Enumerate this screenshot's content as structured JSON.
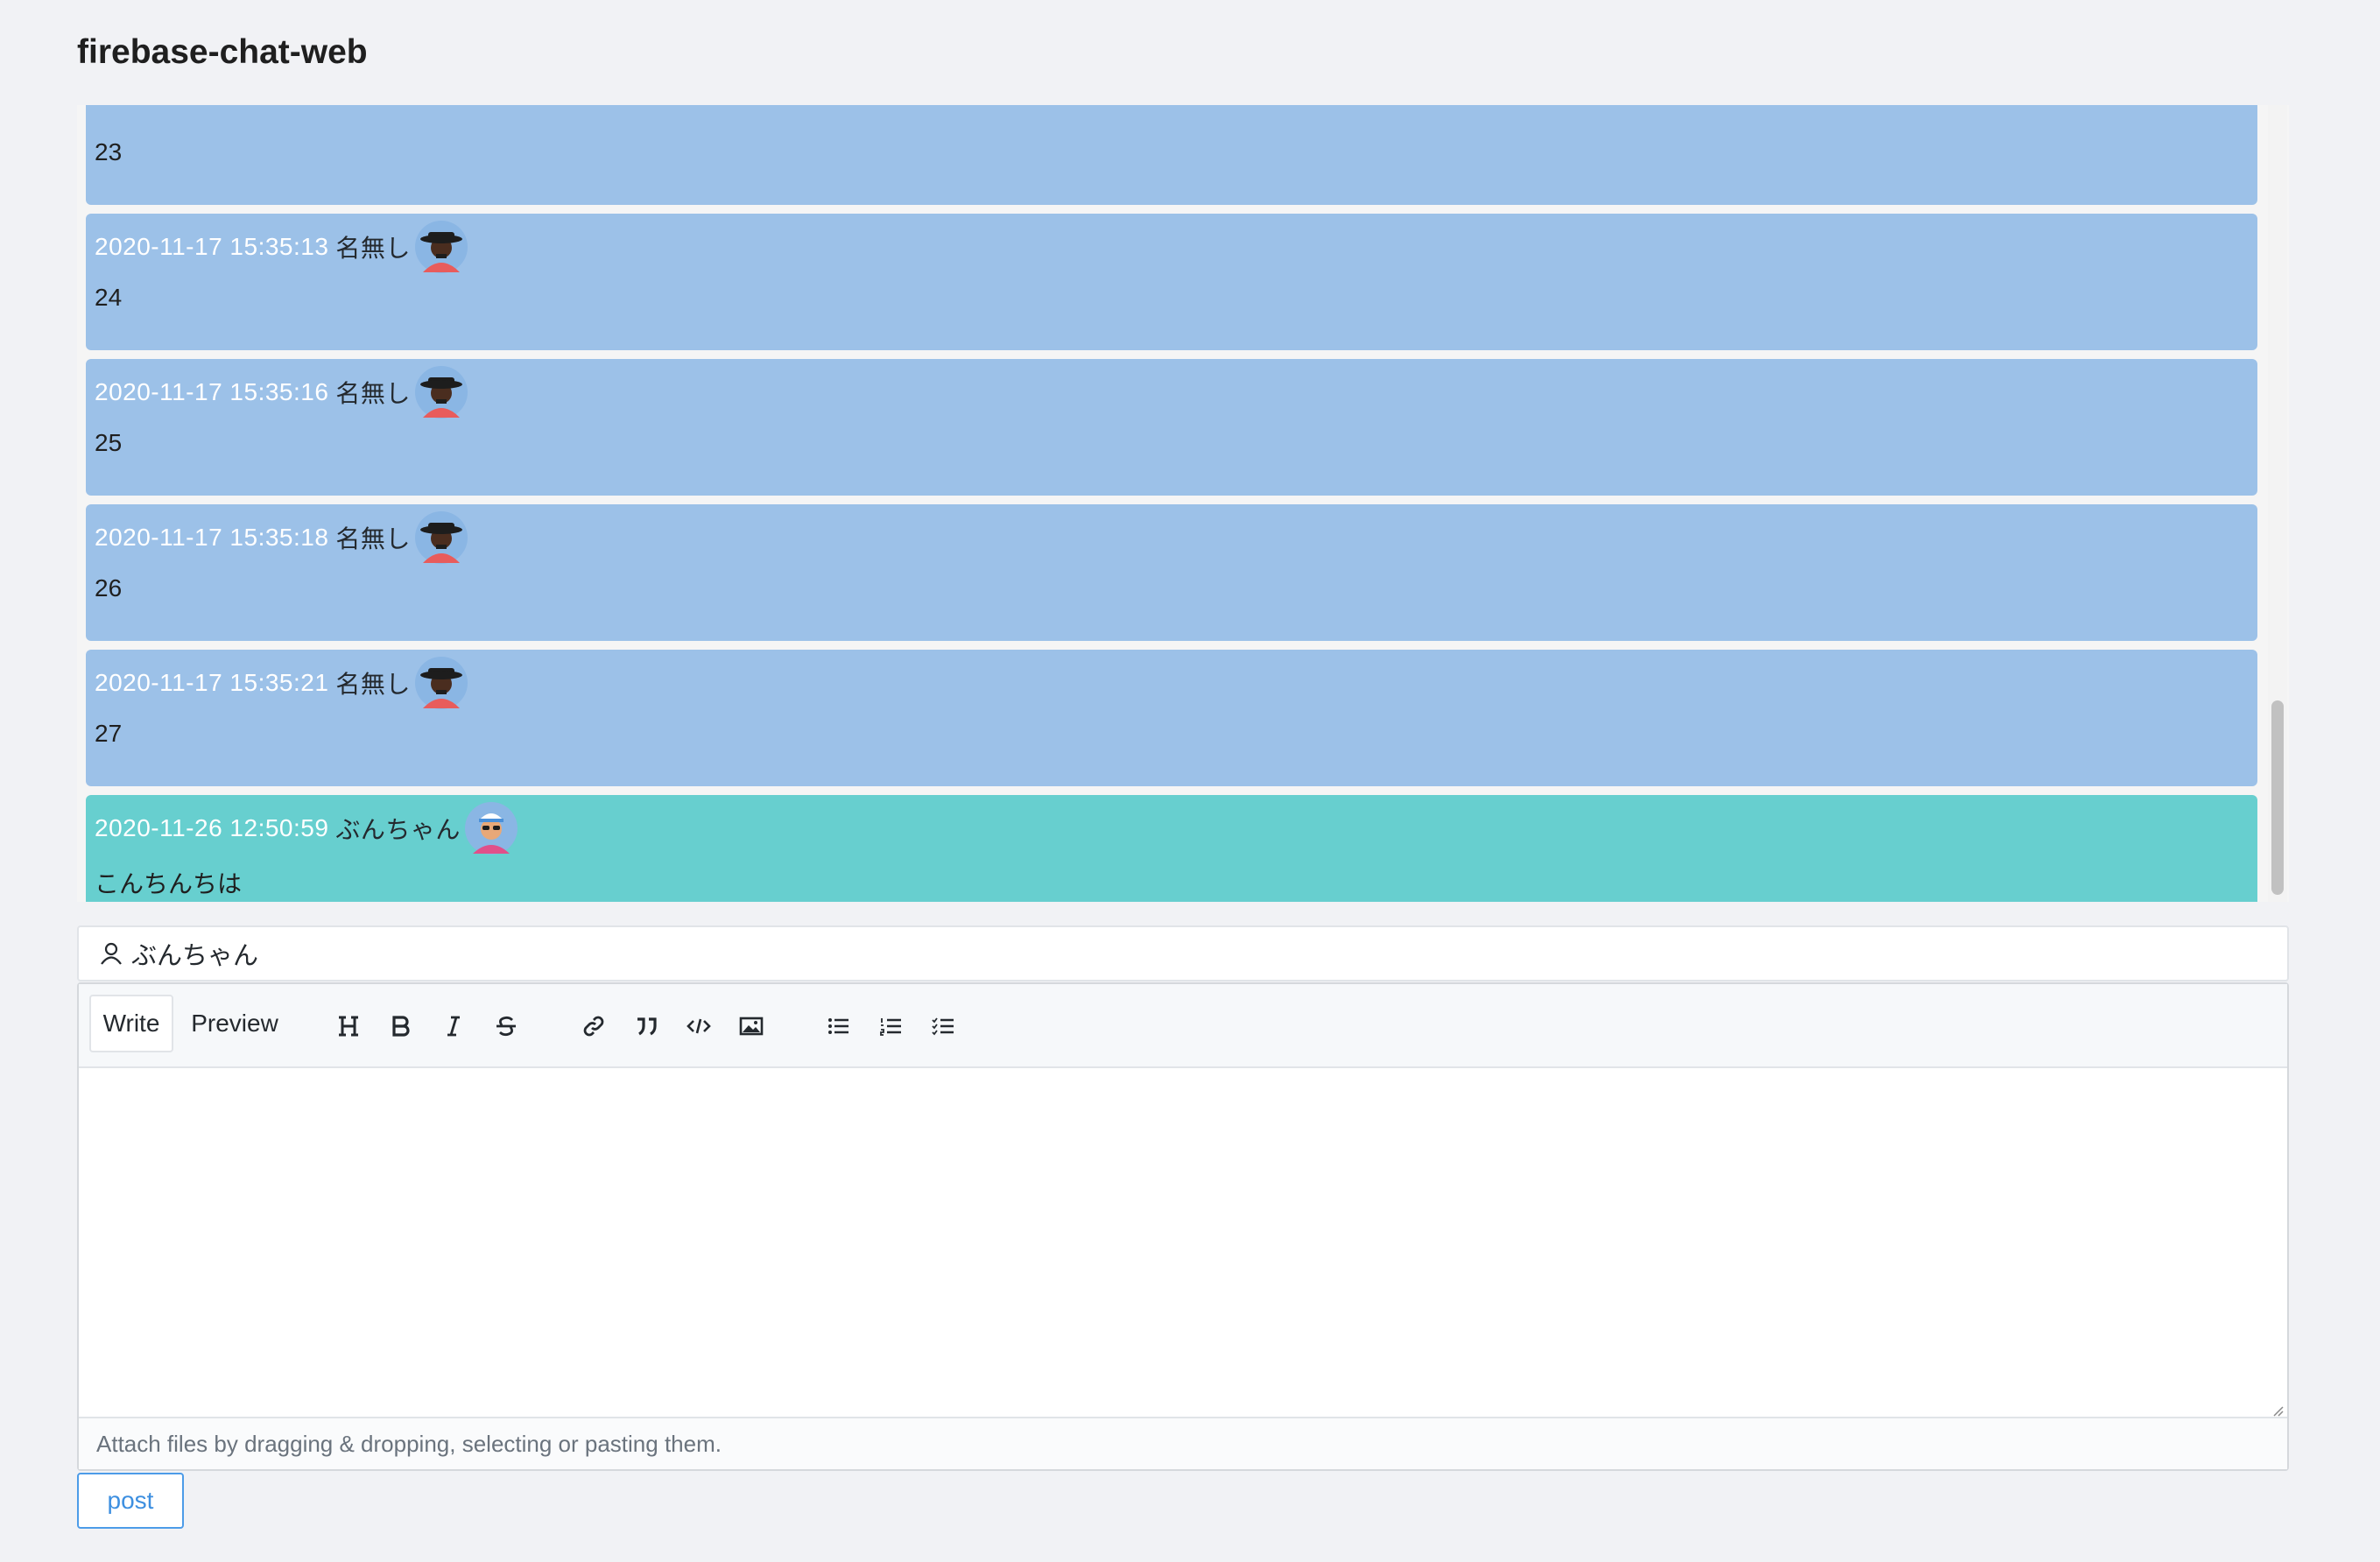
{
  "app": {
    "title": "firebase-chat-web"
  },
  "messages": [
    {
      "time": "",
      "name": "",
      "body": "23",
      "self": false,
      "partial": true
    },
    {
      "time": "2020-11-17 15:35:13",
      "name": "名無し",
      "body": "24",
      "self": false
    },
    {
      "time": "2020-11-17 15:35:16",
      "name": "名無し",
      "body": "25",
      "self": false
    },
    {
      "time": "2020-11-17 15:35:18",
      "name": "名無し",
      "body": "26",
      "self": false
    },
    {
      "time": "2020-11-17 15:35:21",
      "name": "名無し",
      "body": "27",
      "self": false
    },
    {
      "time": "2020-11-26 12:50:59",
      "name": "ぶんちゃん",
      "body": "こんちんちは",
      "self": true
    }
  ],
  "colors": {
    "other_bg": "#9cc1e8",
    "self_bg": "#67cfcf",
    "post_accent": "#4d9ce8"
  },
  "user": {
    "name": "ぶんちゃん",
    "icon": "person-icon"
  },
  "editor": {
    "tabs": {
      "write": "Write",
      "preview": "Preview"
    },
    "tools": [
      "heading-icon",
      "bold-icon",
      "italic-icon",
      "strikethrough-icon",
      "link-icon",
      "quote-icon",
      "code-icon",
      "image-icon",
      "bulleted-list-icon",
      "numbered-list-icon",
      "task-list-icon"
    ],
    "textarea_value": "",
    "attach_hint": "Attach files by dragging & dropping, selecting or pasting them."
  },
  "post": {
    "label": "post"
  }
}
